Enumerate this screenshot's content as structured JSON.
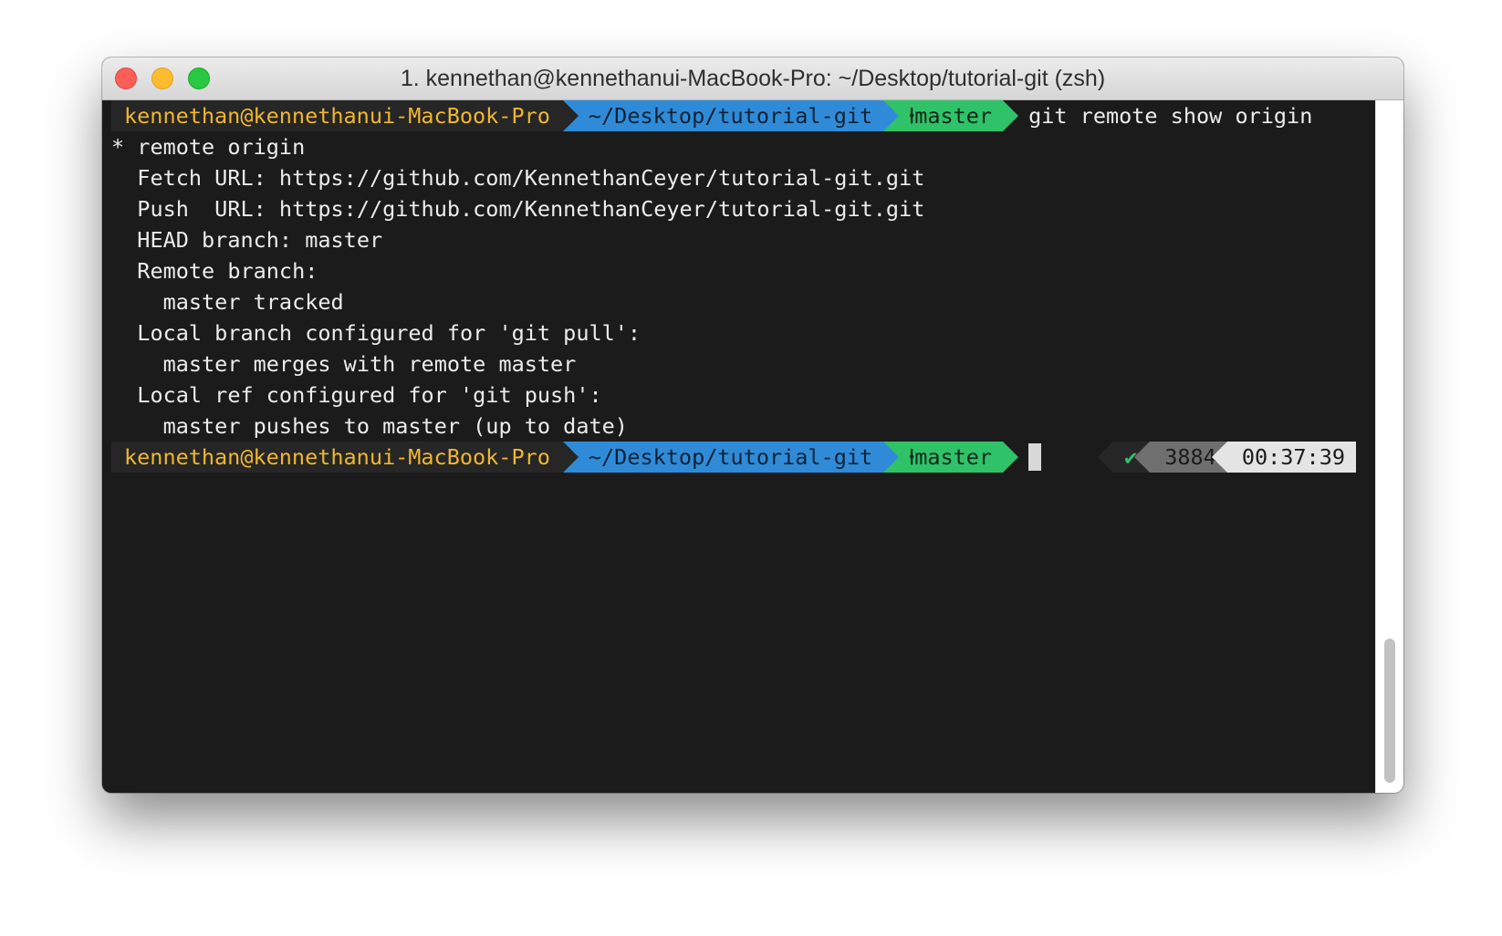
{
  "window": {
    "title": "1. kennethan@kennethanui-MacBook-Pro: ~/Desktop/tutorial-git (zsh)"
  },
  "prompt": {
    "user_host": "kennethan@kennethanui-MacBook-Pro",
    "directory": "~/Desktop/tutorial-git",
    "branch_icon": "⍿",
    "branch_icon_name": "git-branch-icon",
    "branch": "master"
  },
  "command": "git remote show origin",
  "output": [
    "* remote origin",
    "  Fetch URL: https://github.com/KennethanCeyer/tutorial-git.git",
    "  Push  URL: https://github.com/KennethanCeyer/tutorial-git.git",
    "  HEAD branch: master",
    "  Remote branch:",
    "    master tracked",
    "  Local branch configured for 'git pull':",
    "    master merges with remote master",
    "  Local ref configured for 'git push':",
    "    master pushes to master (up to date)"
  ],
  "right_prompt": {
    "status": "✔",
    "status_icon_name": "check-icon",
    "history_number": "3884",
    "time": "00:37:39"
  },
  "colors": {
    "terminal_bg": "#1b1b1b",
    "user_fg": "#f1b72c",
    "dir_bg": "#2f8bd7",
    "git_bg": "#2fc268",
    "close": "#fc5f57",
    "minimize": "#fdbc2e",
    "zoom": "#28c840"
  }
}
